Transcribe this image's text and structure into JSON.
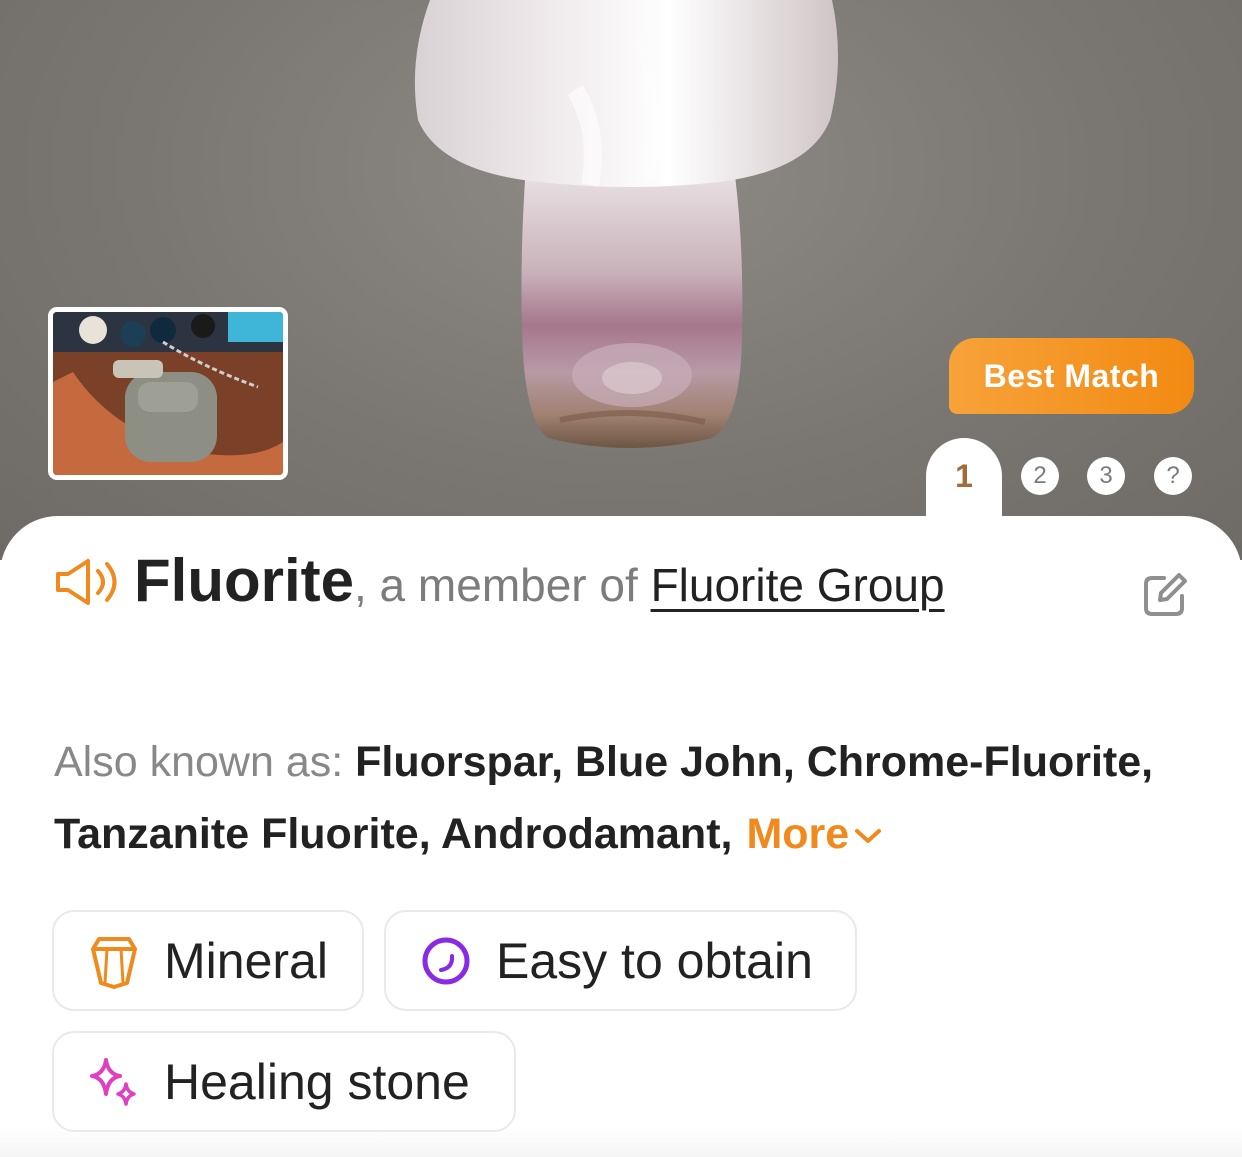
{
  "colors": {
    "accent": "#f08a1c",
    "badge_start": "#f7a23a",
    "badge_end": "#f28a12",
    "pager_active": "#a26b3a",
    "mineral_icon": "#f08a1c",
    "obtain_icon": "#8a2be2",
    "healing_icon": "#e040c0"
  },
  "hero": {
    "badge_label": "Best Match",
    "pager": [
      "1",
      "2",
      "3",
      "?"
    ],
    "active_index": 0
  },
  "result": {
    "name": "Fluorite",
    "member_prefix": ", a member of ",
    "group": "Fluorite Group",
    "aka_label": "Also known as: ",
    "aka_values": "Fluorspar, Blue John, Chrome-Fluorite, Tanzanite Fluorite, Androdamant,",
    "more_label": "More"
  },
  "tags": [
    {
      "label": "Mineral",
      "icon": "crystal-icon"
    },
    {
      "label": "Easy to obtain",
      "icon": "ring-icon"
    },
    {
      "label": "Healing stone",
      "icon": "sparkle-icon"
    }
  ]
}
